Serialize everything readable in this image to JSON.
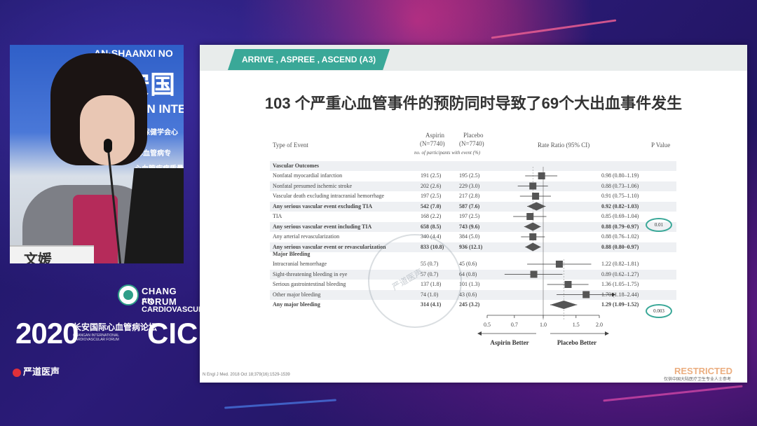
{
  "speaker": {
    "banner_line1": "AN·SHAANXI NO",
    "banner_line2": "安国",
    "banner_line3": "GAN INTE",
    "banner_line4": "省保健学会心",
    "banner_line5": "医学会心血管病专",
    "banner_line6": "心血管疾病质量",
    "name_card": "文媛"
  },
  "conference": {
    "logo_line1": "CHANG FORUM",
    "logo_line2": "AN CARDIOVASCULAR",
    "year": "2020",
    "title_cn": "长安国际心血管病论坛",
    "subtitle": "CHANGAN INTERNATIONAL CARDIOVASCULAR FORUM",
    "short": "CIC"
  },
  "media_logo": "严道医声",
  "slide": {
    "tag": "ARRIVE , ASPREE , ASCEND (A3)",
    "title": "103 个严重心血管事件的预防同时导致了69个大出血事件发生",
    "headers": {
      "type": "Type of Event",
      "aspirin": "Aspirin",
      "aspirin_n": "(N=7740)",
      "placebo": "Placebo",
      "placebo_n": "(N=7740)",
      "subhdr": "no. of participants with event (%)",
      "ratio": "Rate Ratio (95% CI)",
      "pvalue": "P Value"
    },
    "section1": "Vascular Outcomes",
    "section2": "Major Bleeding",
    "rows1": [
      {
        "label": "Nonfatal myocardial infarction",
        "aspirin": "191 (2.5)",
        "placebo": "195 (2.5)",
        "ci": "0.98 (0.80–1.19)"
      },
      {
        "label": "Nonfatal presumed ischemic stroke",
        "aspirin": "202 (2.6)",
        "placebo": "229 (3.0)",
        "ci": "0.88 (0.73–1.06)"
      },
      {
        "label": "Vascular death excluding intracranial hemorrhage",
        "aspirin": "197 (2.5)",
        "placebo": "217 (2.8)",
        "ci": "0.91 (0.75–1.10)"
      },
      {
        "label": "Any serious vascular event excluding TIA",
        "aspirin": "542 (7.0)",
        "placebo": "587 (7.6)",
        "ci": "0.92 (0.82–1.03)"
      },
      {
        "label": "TIA",
        "aspirin": "168 (2.2)",
        "placebo": "197 (2.5)",
        "ci": "0.85 (0.69–1.04)"
      },
      {
        "label": "Any serious vascular event including TIA",
        "aspirin": "658 (8.5)",
        "placebo": "743 (9.6)",
        "ci": "0.88 (0.79–0.97)"
      },
      {
        "label": "Any arterial revascularization",
        "aspirin": "340 (4.4)",
        "placebo": "384 (5.0)",
        "ci": "0.88 (0.76–1.02)"
      },
      {
        "label": "Any serious vascular event or revascularization",
        "aspirin": "833 (10.8)",
        "placebo": "936 (12.1)",
        "ci": "0.88 (0.80–0.97)"
      }
    ],
    "rows2": [
      {
        "label": "Intracranial hemorrhage",
        "aspirin": "55 (0.7)",
        "placebo": "45 (0.6)",
        "ci": "1.22 (0.82–1.81)"
      },
      {
        "label": "Sight-threatening bleeding in eye",
        "aspirin": "57 (0.7)",
        "placebo": "64 (0.8)",
        "ci": "0.89 (0.62–1.27)"
      },
      {
        "label": "Serious gastrointestinal bleeding",
        "aspirin": "137 (1.8)",
        "placebo": "101 (1.3)",
        "ci": "1.36 (1.05–1.75)"
      },
      {
        "label": "Other major bleeding",
        "aspirin": "74 (1.0)",
        "placebo": "43 (0.6)",
        "ci": "1.70 (1.18–2.44)"
      },
      {
        "label": "Any major bleeding",
        "aspirin": "314 (4.1)",
        "placebo": "245 (3.2)",
        "ci": "1.29 (1.09–1.52)"
      }
    ],
    "pvalue1": "0.01",
    "pvalue2": "0.003",
    "axis_ticks": [
      "0.5",
      "0.7",
      "1.0",
      "1.5",
      "2.0"
    ],
    "axis_left_label": "Aspirin Better",
    "axis_right_label": "Placebo Better",
    "footer_ref": "N Engl J Med. 2018 Oct 18;379(16):1529-1539",
    "restricted": "RESTRICTED",
    "footer_right": "仅供中国大陆医疗卫生专业人士参考",
    "watermark": "严道医声"
  },
  "forest": {
    "axis": {
      "min": 0.5,
      "max": 2.0,
      "ref": 1.0
    },
    "rows1": [
      {
        "est": 0.98,
        "lo": 0.8,
        "hi": 1.19,
        "shape": "square",
        "bold": false
      },
      {
        "est": 0.88,
        "lo": 0.73,
        "hi": 1.06,
        "shape": "square",
        "bold": false
      },
      {
        "est": 0.91,
        "lo": 0.75,
        "hi": 1.1,
        "shape": "square",
        "bold": false
      },
      {
        "est": 0.92,
        "lo": 0.82,
        "hi": 1.03,
        "shape": "diamond",
        "bold": true
      },
      {
        "est": 0.85,
        "lo": 0.69,
        "hi": 1.04,
        "shape": "square",
        "bold": false
      },
      {
        "est": 0.88,
        "lo": 0.79,
        "hi": 0.97,
        "shape": "diamond",
        "bold": true
      },
      {
        "est": 0.88,
        "lo": 0.76,
        "hi": 1.02,
        "shape": "square",
        "bold": false
      },
      {
        "est": 0.88,
        "lo": 0.8,
        "hi": 0.97,
        "shape": "diamond",
        "bold": true
      }
    ],
    "rows2": [
      {
        "est": 1.22,
        "lo": 0.82,
        "hi": 1.81,
        "shape": "square",
        "bold": false
      },
      {
        "est": 0.89,
        "lo": 0.62,
        "hi": 1.27,
        "shape": "square",
        "bold": false
      },
      {
        "est": 1.36,
        "lo": 1.05,
        "hi": 1.75,
        "shape": "square",
        "bold": false
      },
      {
        "est": 1.7,
        "lo": 1.18,
        "hi": 2.44,
        "shape": "square",
        "bold": false
      },
      {
        "est": 1.29,
        "lo": 1.09,
        "hi": 1.52,
        "shape": "diamond",
        "bold": true
      }
    ]
  },
  "colors": {
    "accent": "#3aa898",
    "background": "#2b1b78"
  }
}
